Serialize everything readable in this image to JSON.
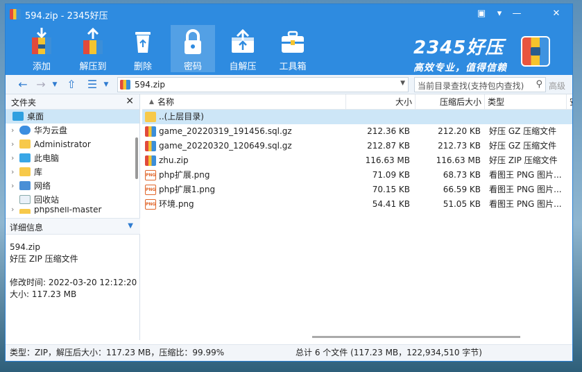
{
  "window": {
    "title": "594.zip - 2345好压",
    "controls": [
      "chat-icon",
      "skin-icon",
      "minimize-icon",
      "close-icon"
    ]
  },
  "toolbar": {
    "items": [
      {
        "label": "添加",
        "icon": "add-icon"
      },
      {
        "label": "解压到",
        "icon": "extract-icon"
      },
      {
        "label": "删除",
        "icon": "delete-icon"
      },
      {
        "label": "密码",
        "icon": "lock-icon",
        "active": true
      },
      {
        "label": "自解压",
        "icon": "self-extract-icon"
      },
      {
        "label": "工具箱",
        "icon": "toolbox-icon"
      }
    ]
  },
  "brand": {
    "name": "2345好压",
    "slogan": "高效专业，值得信赖"
  },
  "addressbar": {
    "path": "594.zip",
    "search_placeholder": "当前目录查找(支持包内查找)",
    "advanced_label": "高级"
  },
  "folders_panel": {
    "title": "文件夹",
    "items": [
      {
        "label": "桌面",
        "icon": "desktop-icon",
        "selected": true,
        "expandable": false
      },
      {
        "label": "华为云盘",
        "icon": "cloud-icon",
        "expandable": true
      },
      {
        "label": "Administrator",
        "icon": "folder-icon",
        "expandable": true
      },
      {
        "label": "此电脑",
        "icon": "computer-icon",
        "expandable": true
      },
      {
        "label": "库",
        "icon": "folder-icon",
        "expandable": true
      },
      {
        "label": "网络",
        "icon": "network-icon",
        "expandable": true
      },
      {
        "label": "回收站",
        "icon": "recycle-bin-icon",
        "expandable": false
      },
      {
        "label": "phpshell-master",
        "icon": "folder-icon",
        "expandable": true
      }
    ]
  },
  "details_panel": {
    "title": "详细信息",
    "filename": "594.zip",
    "type": "好压 ZIP 压缩文件",
    "modified": "修改时间: 2022-03-20 12:12:20",
    "size": "大小: 117.23 MB"
  },
  "file_list": {
    "columns": [
      "名称",
      "大小",
      "压缩后大小",
      "类型",
      "安"
    ],
    "rows": [
      {
        "name": "..(上层目录)",
        "size": "",
        "packed": "",
        "type": "",
        "icon": "folder"
      },
      {
        "name": "game_20220319_191456.sql.gz",
        "size": "212.36 KB",
        "packed": "212.20 KB",
        "type": "好压 GZ 压缩文件",
        "icon": "archive"
      },
      {
        "name": "game_20220320_120649.sql.gz",
        "size": "212.87 KB",
        "packed": "212.73 KB",
        "type": "好压 GZ 压缩文件",
        "icon": "archive"
      },
      {
        "name": "zhu.zip",
        "size": "116.63 MB",
        "packed": "116.63 MB",
        "type": "好压 ZIP 压缩文件",
        "icon": "archive"
      },
      {
        "name": "php扩展.png",
        "size": "71.09 KB",
        "packed": "68.73 KB",
        "type": "看图王 PNG 图片...",
        "icon": "png"
      },
      {
        "name": "php扩展1.png",
        "size": "70.15 KB",
        "packed": "66.59 KB",
        "type": "看图王 PNG 图片...",
        "icon": "png"
      },
      {
        "name": "环境.png",
        "size": "54.41 KB",
        "packed": "51.05 KB",
        "type": "看图王 PNG 图片...",
        "icon": "png"
      }
    ]
  },
  "statusbar": {
    "left": "类型：ZIP，解压后大小：117.23 MB，压缩比：99.99%",
    "right": "总计 6 个文件 (117.23 MB，122,934,510 字节)"
  },
  "colors": {
    "accent": "#2e8be0",
    "selection": "#cde6f7"
  }
}
